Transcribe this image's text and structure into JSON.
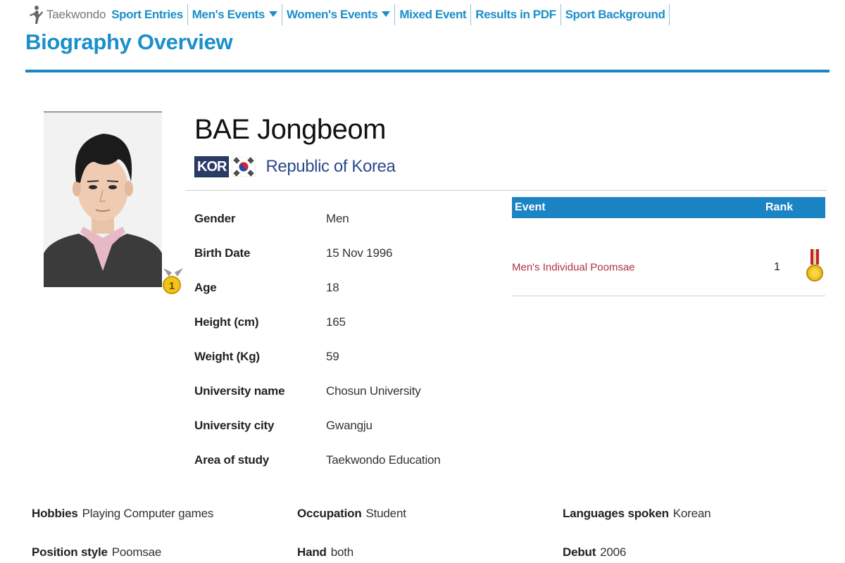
{
  "nav": {
    "sport_name": "Taekwondo",
    "items": [
      {
        "label": "Sport Entries",
        "dropdown": false
      },
      {
        "label": "Men's Events",
        "dropdown": true
      },
      {
        "label": "Women's Events",
        "dropdown": true
      },
      {
        "label": "Mixed Event",
        "dropdown": false
      },
      {
        "label": "Results in PDF",
        "dropdown": false
      },
      {
        "label": "Sport Background",
        "dropdown": false
      }
    ]
  },
  "page_title": "Biography Overview",
  "athlete": {
    "name": "BAE Jongbeom",
    "country_code": "KOR",
    "country_name": "Republic of Korea",
    "medal_count_badge": "1"
  },
  "bio": [
    {
      "label": "Gender",
      "value": "Men"
    },
    {
      "label": "Birth Date",
      "value": "15 Nov 1996"
    },
    {
      "label": "Age",
      "value": "18"
    },
    {
      "label": "Height (cm)",
      "value": "165"
    },
    {
      "label": "Weight (Kg)",
      "value": "59"
    },
    {
      "label": "University name",
      "value": "Chosun University"
    },
    {
      "label": "University city",
      "value": "Gwangju"
    },
    {
      "label": "Area of study",
      "value": "Taekwondo Education"
    }
  ],
  "results": {
    "headers": {
      "event": "Event",
      "rank": "Rank"
    },
    "rows": [
      {
        "event": "Men's Individual Poomsae",
        "rank": "1",
        "medal": "gold-medal-icon"
      }
    ]
  },
  "extra": {
    "hobbies": {
      "label": "Hobbies",
      "value": "Playing Computer games"
    },
    "occupation": {
      "label": "Occupation",
      "value": "Student"
    },
    "languages": {
      "label": "Languages spoken",
      "value": "Korean"
    },
    "position_style": {
      "label": "Position style",
      "value": "Poomsae"
    },
    "hand": {
      "label": "Hand",
      "value": "both"
    },
    "debut": {
      "label": "Debut",
      "value": "2006"
    }
  },
  "colors": {
    "accent": "#1a8fc9",
    "table_header": "#1a84c4",
    "event_link": "#b0304a",
    "country_name": "#2a4a8e"
  }
}
